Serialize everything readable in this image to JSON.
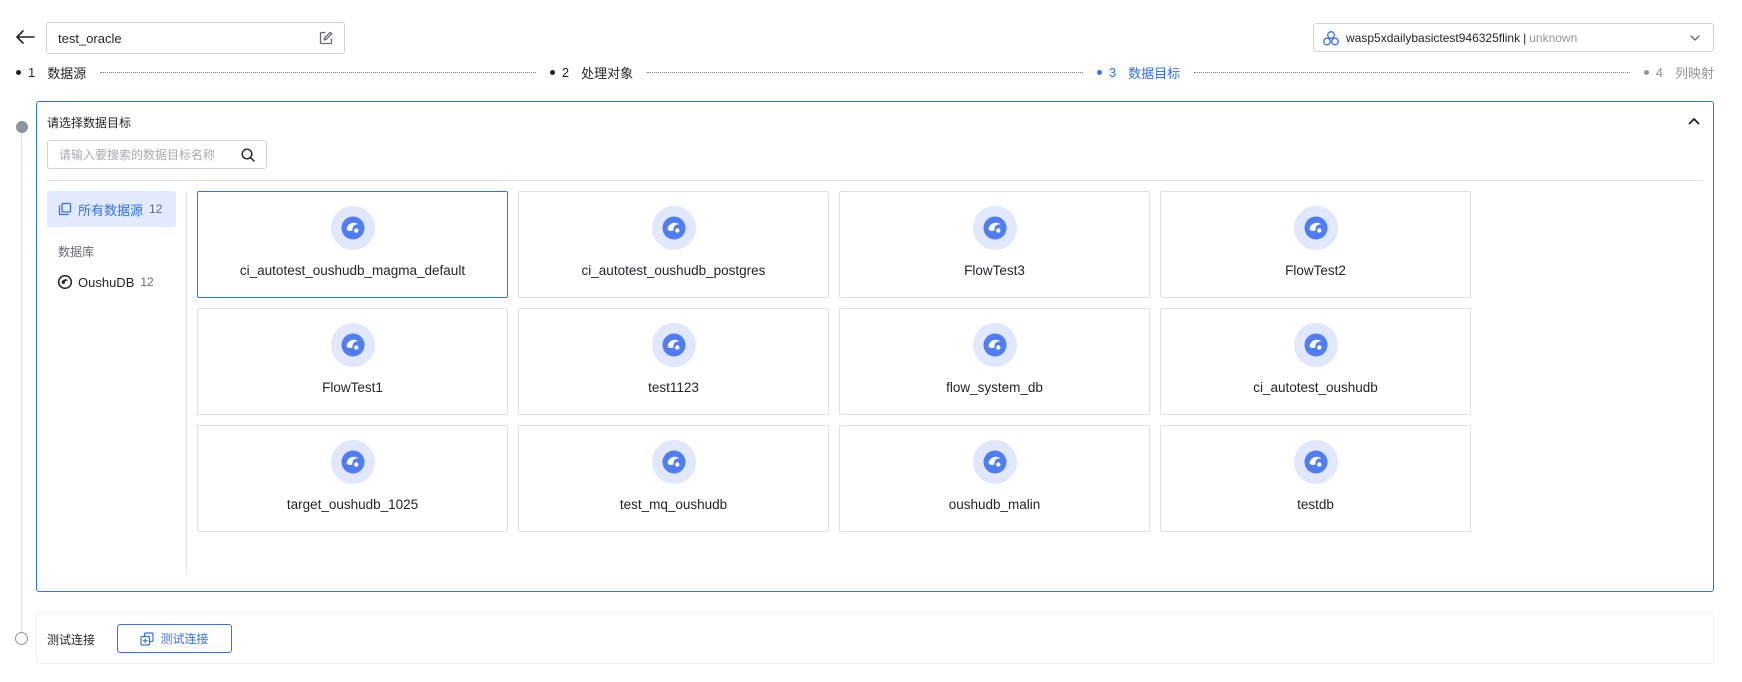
{
  "header": {
    "task_name": "test_oracle",
    "workspace": {
      "name": "wasp5xdailybasictest946325flink",
      "separator": "|",
      "status": "unknown"
    }
  },
  "steps": [
    {
      "num": "1",
      "label": "数据源"
    },
    {
      "num": "2",
      "label": "处理对象"
    },
    {
      "num": "3",
      "label": "数据目标"
    },
    {
      "num": "4",
      "label": "列映射"
    }
  ],
  "panel": {
    "title": "请选择数据目标",
    "search_placeholder": "请输入要搜索的数据目标名称",
    "categories": {
      "all_label": "所有数据源",
      "all_count": "12",
      "group_heading": "数据库",
      "db_label": "OushuDB",
      "db_count": "12"
    },
    "targets": [
      "ci_autotest_oushudb_magma_default",
      "ci_autotest_oushudb_postgres",
      "FlowTest3",
      "FlowTest2",
      "FlowTest1",
      "test1123",
      "flow_system_db",
      "ci_autotest_oushudb",
      "target_oushudb_1025",
      "test_mq_oushudb",
      "oushudb_malin",
      "testdb"
    ],
    "selected_index": 0
  },
  "test_connection": {
    "label": "测试连接",
    "button_label": "测试连接"
  },
  "colors": {
    "accent": "#3370ff",
    "logo_bg": "#e1e8fd",
    "active_bg": "#e1eaff"
  },
  "icons": [
    "back-arrow-icon",
    "edit-icon",
    "workspace-icon",
    "chevron-down-icon",
    "chevron-up-icon",
    "search-icon",
    "copy-icon",
    "oushudb-logo-icon"
  ]
}
